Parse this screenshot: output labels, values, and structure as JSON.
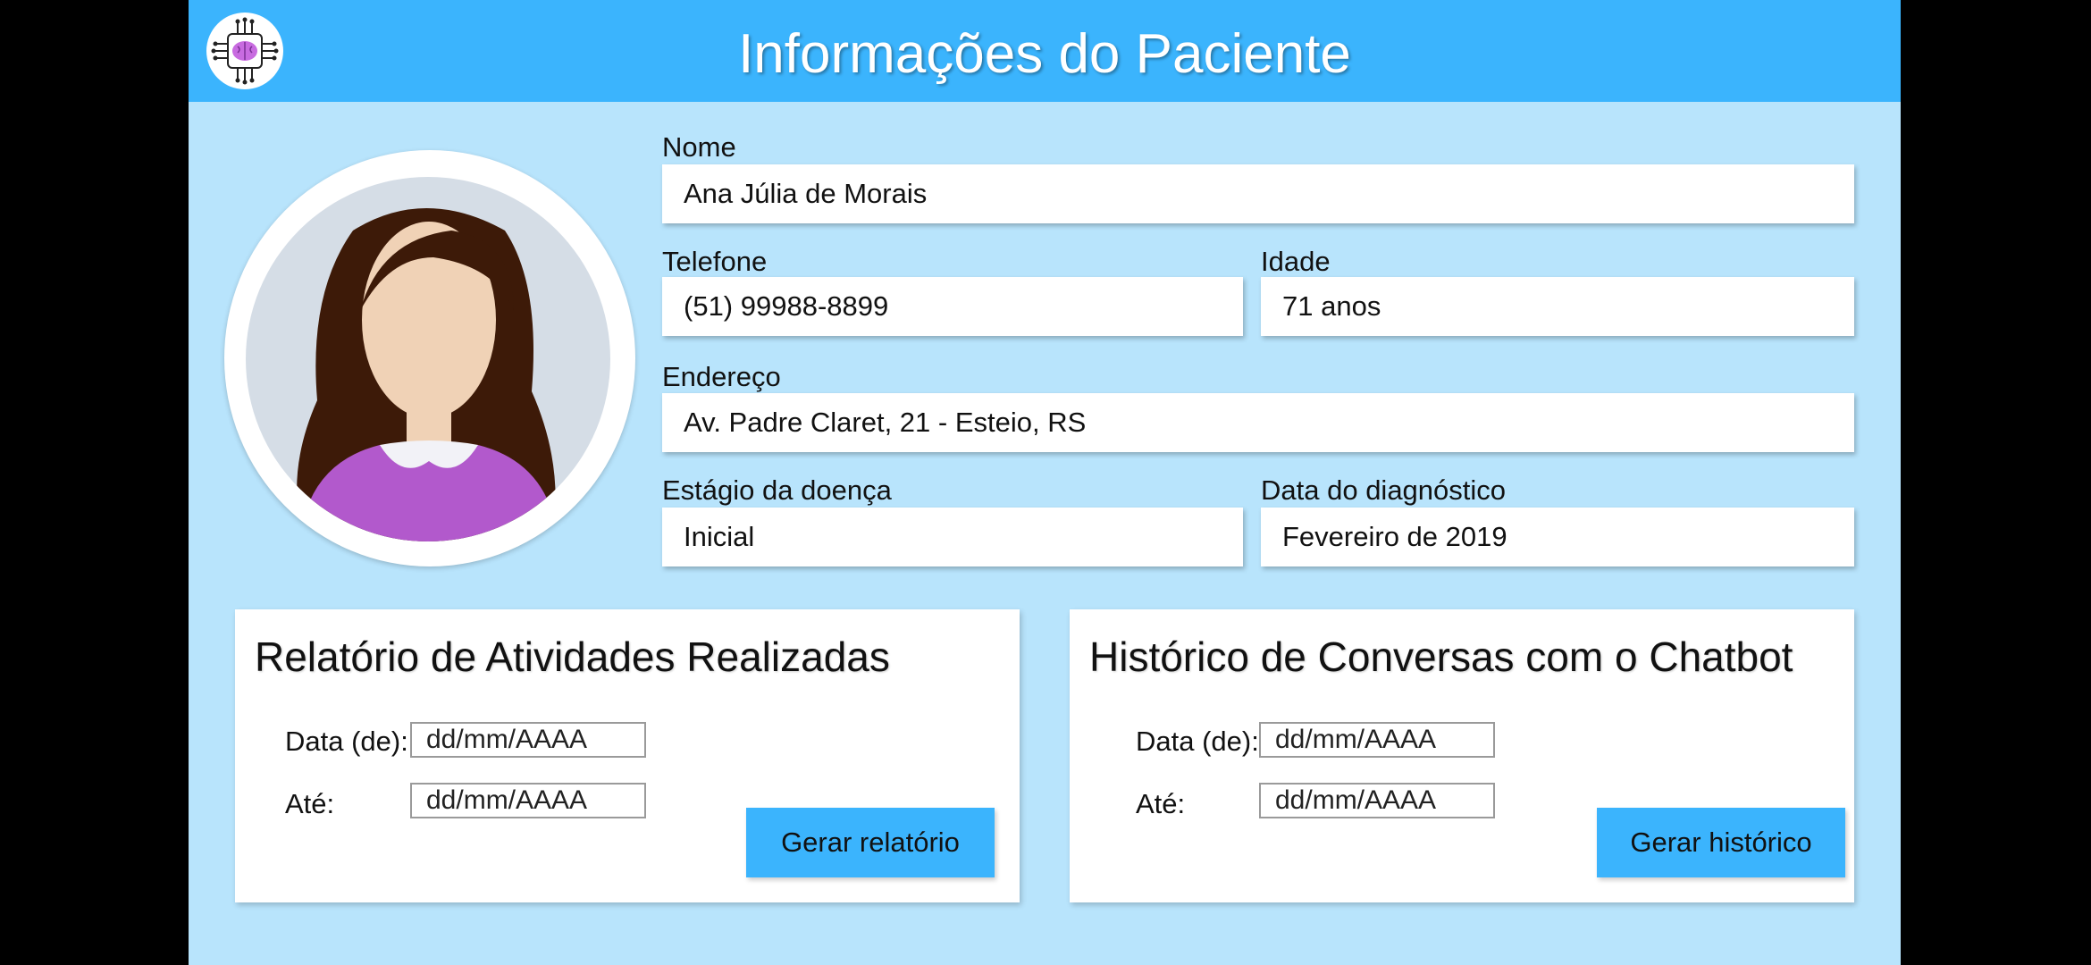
{
  "header": {
    "title": "Informações do Paciente",
    "logo_icon": "brain-circuit-icon"
  },
  "patient": {
    "avatar_icon": "female-avatar-icon",
    "fields": {
      "nome": {
        "label": "Nome",
        "value": "Ana Júlia de Morais"
      },
      "telefone": {
        "label": "Telefone",
        "value": "(51) 99988-8899"
      },
      "idade": {
        "label": "Idade",
        "value": "71 anos"
      },
      "endereco": {
        "label": "Endereço",
        "value": "Av. Padre Claret, 21 - Esteio, RS"
      },
      "estagio": {
        "label": "Estágio da doença",
        "value": "Inicial"
      },
      "diagnostico": {
        "label": "Data do diagnóstico",
        "value": "Fevereiro de 2019"
      }
    }
  },
  "reports": {
    "title": "Relatório de Atividades Realizadas",
    "from_label": "Data (de):",
    "to_label": "Até:",
    "from_placeholder": "dd/mm/AAAA",
    "to_placeholder": "dd/mm/AAAA",
    "button": "Gerar relatório"
  },
  "history": {
    "title": "Histórico de Conversas com o Chatbot",
    "from_label": "Data (de):",
    "to_label": "Até:",
    "from_placeholder": "dd/mm/AAAA",
    "to_placeholder": "dd/mm/AAAA",
    "button": "Gerar histórico"
  },
  "colors": {
    "header": "#3bb4fd",
    "background": "#b8e4fc",
    "button": "#3bb4fd",
    "brain": "#c86be0",
    "shirt": "#b259cc",
    "hair": "#3d1a08",
    "skin": "#f0d2b6"
  }
}
